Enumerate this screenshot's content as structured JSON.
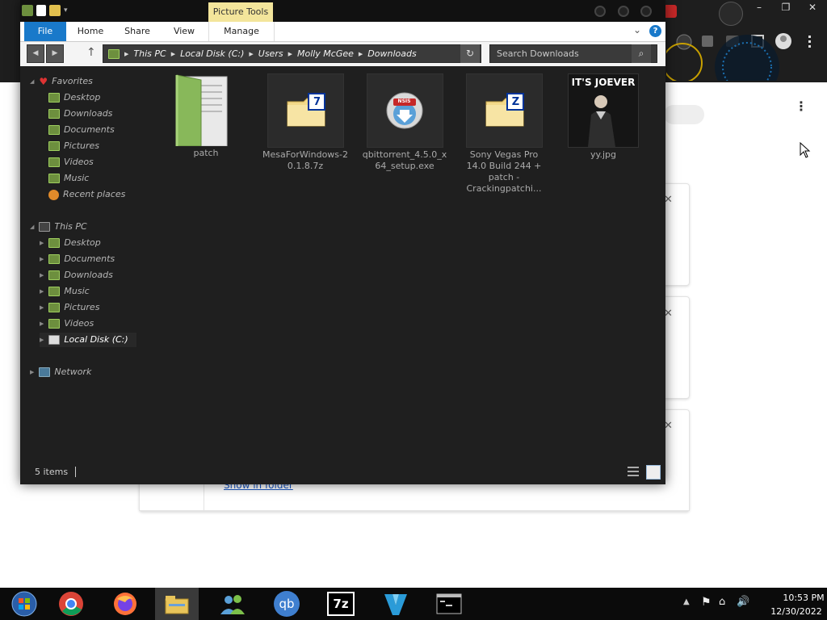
{
  "explorer": {
    "picture_tools_label": "Picture Tools",
    "ribbon_tabs": [
      "File",
      "Home",
      "Share",
      "View",
      "Manage"
    ],
    "help": "?",
    "address": {
      "crumbs": [
        "This PC",
        "Local Disk (C:)",
        "Users",
        "Molly McGee",
        "Downloads"
      ]
    },
    "search_placeholder": "Search Downloads",
    "nav": {
      "favorites_label": "Favorites",
      "favorites": [
        "Desktop",
        "Downloads",
        "Documents",
        "Pictures",
        "Videos",
        "Music",
        "Recent places"
      ],
      "this_pc_label": "This PC",
      "this_pc": [
        "Desktop",
        "Documents",
        "Downloads",
        "Music",
        "Pictures",
        "Videos",
        "Local Disk (C:)"
      ],
      "network_label": "Network"
    },
    "files": [
      {
        "name": "patch",
        "kind": "folder"
      },
      {
        "name": "MesaForWindows-20.1.8.7z",
        "kind": "archive-7z",
        "badge": "7"
      },
      {
        "name": "qbittorrent_4.5.0_x64_setup.exe",
        "kind": "installer",
        "badge": "NSIS"
      },
      {
        "name": "Sony Vegas Pro 14.0 Build 244 + patch - Crackingpatchi...",
        "kind": "archive-zip",
        "badge": "Z"
      },
      {
        "name": "yy.jpg",
        "kind": "image",
        "caption": "IT'S JOEVER"
      }
    ],
    "status": {
      "item_count": "5 items"
    }
  },
  "background": {
    "show_in_folder": "Show in folder"
  },
  "taskbar": {
    "apps": [
      "start-orb",
      "chrome",
      "firefox",
      "file-explorer",
      "messenger",
      "qbittorrent",
      "7zip",
      "editor",
      "terminal"
    ],
    "qb_label": "qb",
    "sevenzip_label": "7z",
    "clock": {
      "time": "10:53 PM",
      "date": "12/30/2022"
    }
  },
  "colors": {
    "file_tab": "#1979ca",
    "picture_tools": "#f3e59b",
    "folder_green": "#6d8f3e",
    "explorer_bg": "#1f1f1f",
    "taskbar_bg": "#0b0b0b"
  }
}
